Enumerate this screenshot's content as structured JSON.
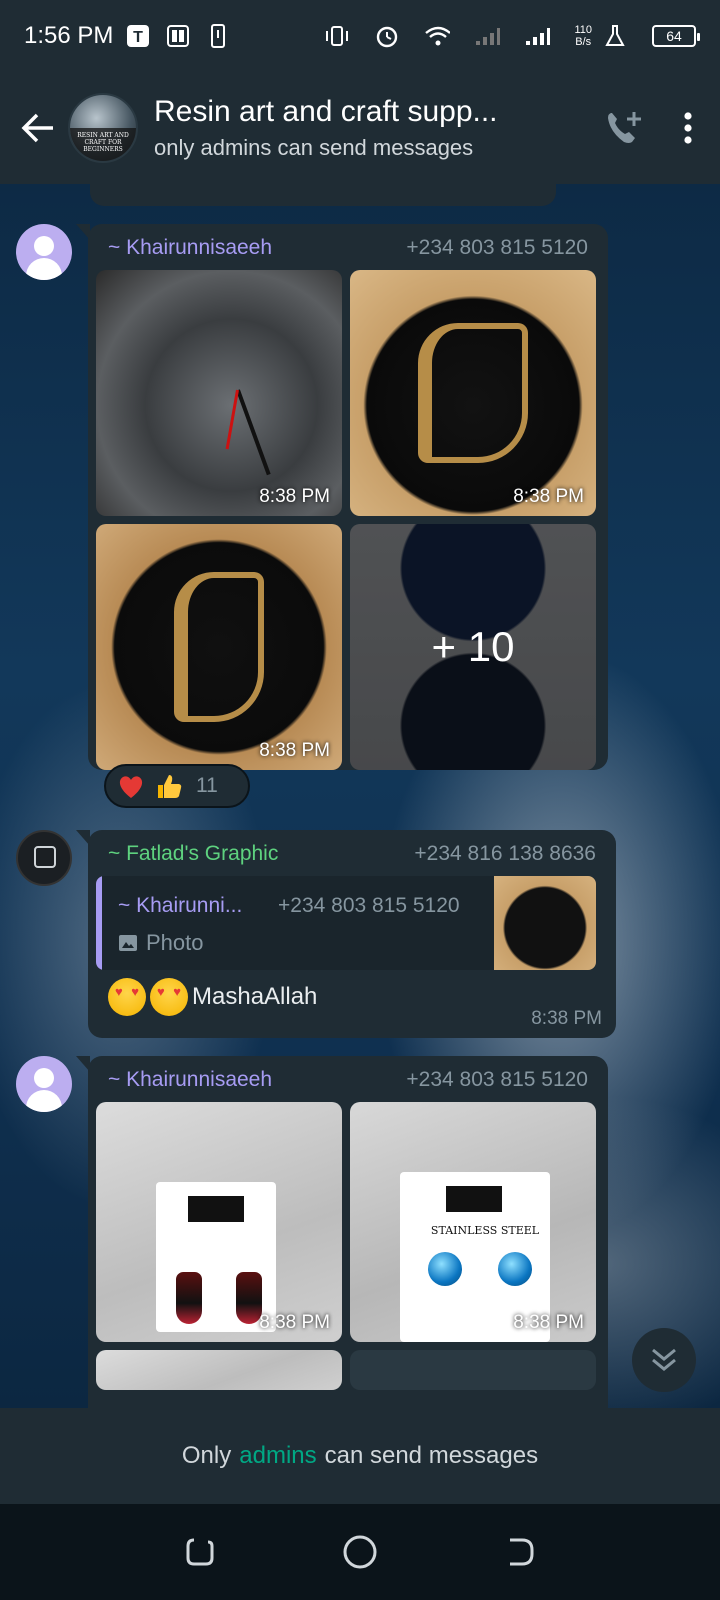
{
  "status_bar": {
    "time": "1:56 PM",
    "network_speed_value": "110",
    "network_speed_unit": "B/s",
    "battery": "64",
    "icons": [
      "t-app-icon",
      "parking-app-icon",
      "phone-app-icon",
      "vibrate-icon",
      "alarm-icon",
      "wifi-icon",
      "signal-icon",
      "signal-icon",
      "lab-icon",
      "battery-icon"
    ]
  },
  "header": {
    "title": "Resin art and craft supp...",
    "subtitle": "only admins can send messages",
    "avatar_text": "RESIN ART AND CRAFT FOR BEGINNERS"
  },
  "messages": [
    {
      "sender": "~ Khairunnisaeeh",
      "phone": "+234 803 815 5120",
      "photos": [
        {
          "time": "8:38 PM"
        },
        {
          "time": "8:38 PM"
        },
        {
          "time": "8:38 PM"
        },
        {
          "more": "+ 10"
        }
      ],
      "reactions": {
        "count": "11"
      }
    },
    {
      "sender": "~ Fatlad's Graphic",
      "phone": "+234 816 138 8636",
      "quote": {
        "sender": "~ Khairunni...",
        "phone": "+234 803 815 5120",
        "type": "Photo"
      },
      "text": "MashaAllah",
      "time": "8:38 PM"
    },
    {
      "sender": "~ Khairunnisaeeh",
      "phone": "+234 803 815 5120",
      "photos": [
        {
          "time": "8:38 PM"
        },
        {
          "time": "8:38 PM"
        }
      ],
      "photo_label": "STAINLESS STEEL"
    }
  ],
  "footer": {
    "prefix": "Only",
    "link": "admins",
    "suffix": "can send messages"
  },
  "colors": {
    "bubble": "#1f2c34",
    "accent_green": "#00a884",
    "sender_purple": "#a79cf3",
    "sender_green": "#5ed27f"
  }
}
